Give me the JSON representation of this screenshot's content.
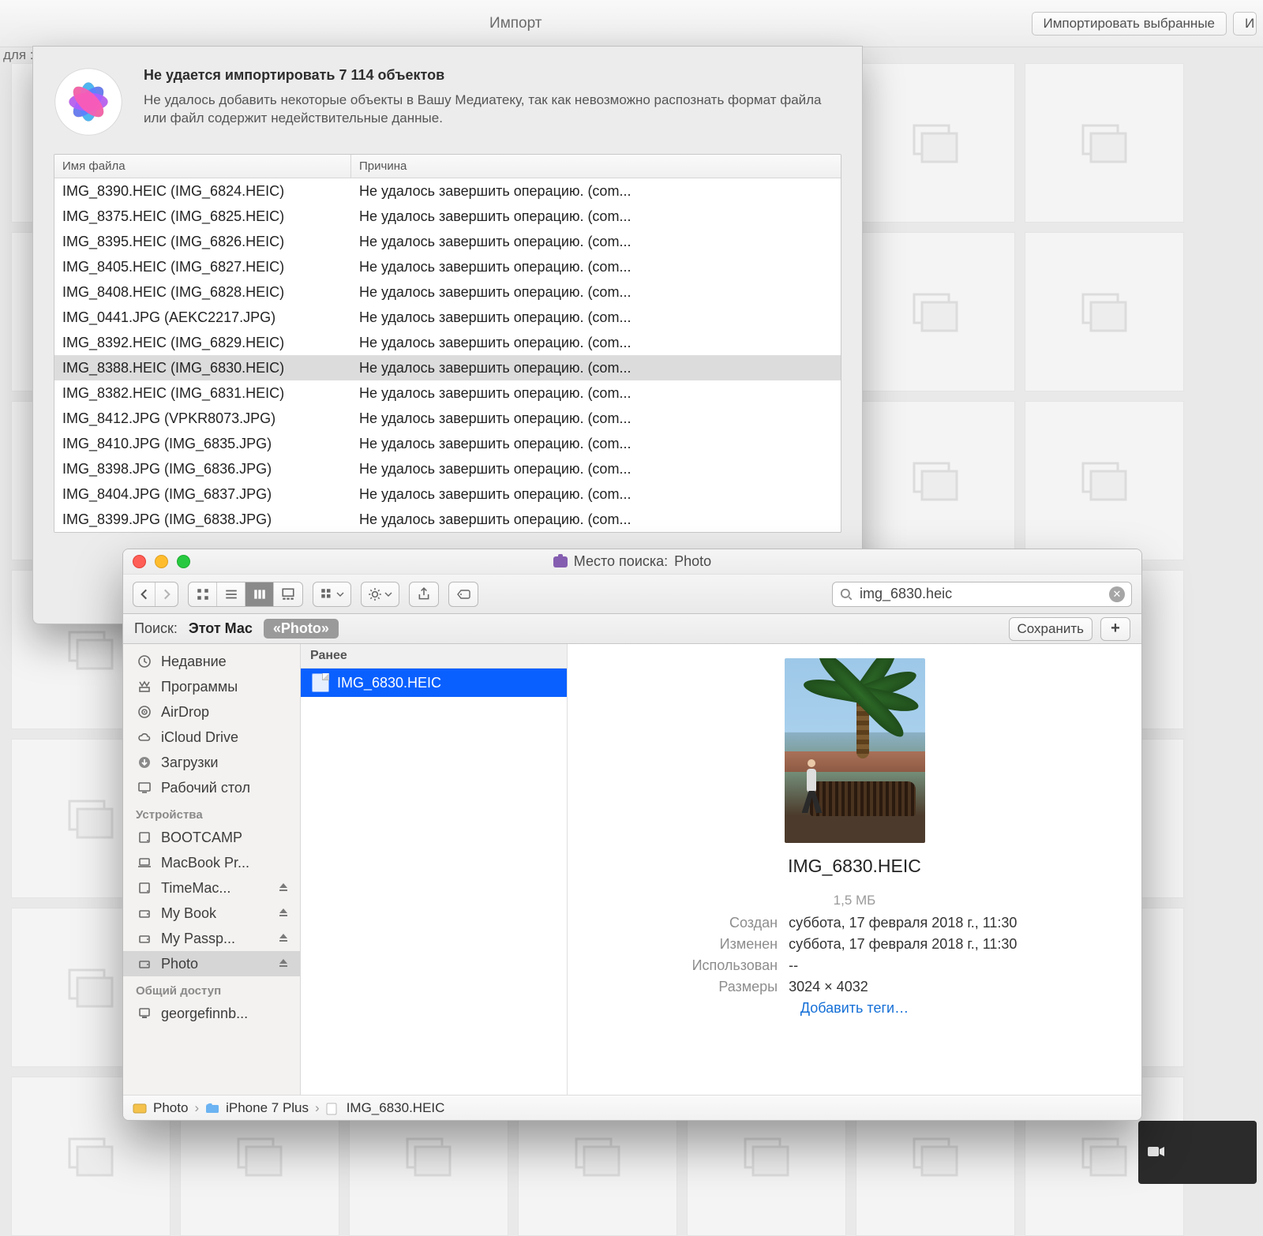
{
  "photos_toolbar": {
    "title": "Импорт",
    "import_selected": "Импортировать выбранные",
    "import_all_fragment": "И"
  },
  "side_hint": "для :",
  "error_dialog": {
    "heading": "Не удается импортировать 7 114 объектов",
    "subtext": "Не удалось добавить некоторые объекты в Вашу Медиатеку, так как невозможно распознать формат файла или файл содержит недействительные данные.",
    "col_file": "Имя файла",
    "col_reason": "Причина",
    "rows": [
      {
        "file": "IMG_8390.HEIC (IMG_6824.HEIC)",
        "reason": "Не удалось завершить операцию. (com...",
        "sel": false
      },
      {
        "file": "IMG_8375.HEIC (IMG_6825.HEIC)",
        "reason": "Не удалось завершить операцию. (com...",
        "sel": false
      },
      {
        "file": "IMG_8395.HEIC (IMG_6826.HEIC)",
        "reason": "Не удалось завершить операцию. (com...",
        "sel": false
      },
      {
        "file": "IMG_8405.HEIC (IMG_6827.HEIC)",
        "reason": "Не удалось завершить операцию. (com...",
        "sel": false
      },
      {
        "file": "IMG_8408.HEIC (IMG_6828.HEIC)",
        "reason": "Не удалось завершить операцию. (com...",
        "sel": false
      },
      {
        "file": "IMG_0441.JPG (AEKC2217.JPG)",
        "reason": "Не удалось завершить операцию. (com...",
        "sel": false
      },
      {
        "file": "IMG_8392.HEIC (IMG_6829.HEIC)",
        "reason": "Не удалось завершить операцию. (com...",
        "sel": false
      },
      {
        "file": "IMG_8388.HEIC (IMG_6830.HEIC)",
        "reason": "Не удалось завершить операцию. (com...",
        "sel": true
      },
      {
        "file": "IMG_8382.HEIC (IMG_6831.HEIC)",
        "reason": "Не удалось завершить операцию. (com...",
        "sel": false
      },
      {
        "file": "IMG_8412.JPG (VPKR8073.JPG)",
        "reason": "Не удалось завершить операцию. (com...",
        "sel": false
      },
      {
        "file": "IMG_8410.JPG (IMG_6835.JPG)",
        "reason": "Не удалось завершить операцию. (com...",
        "sel": false
      },
      {
        "file": "IMG_8398.JPG (IMG_6836.JPG)",
        "reason": "Не удалось завершить операцию. (com...",
        "sel": false
      },
      {
        "file": "IMG_8404.JPG (IMG_6837.JPG)",
        "reason": "Не удалось завершить операцию. (com...",
        "sel": false
      },
      {
        "file": "IMG_8399.JPG (IMG_6838.JPG)",
        "reason": "Не удалось завершить операцию. (com...",
        "sel": false
      }
    ]
  },
  "finder": {
    "title_prefix": "Место поиска:",
    "title_folder": "Photo",
    "search_value": "img_6830.heic",
    "scope": {
      "label": "Поиск:",
      "this_mac": "Этот Мас",
      "photo": "«Photo»",
      "save": "Сохранить"
    },
    "sidebar": {
      "favorites_partial": [
        {
          "icon": "clock-icon",
          "label": "Недавние"
        },
        {
          "icon": "app-grid-icon",
          "label": "Программы"
        },
        {
          "icon": "airdrop-icon",
          "label": "AirDrop"
        },
        {
          "icon": "cloud-icon",
          "label": "iCloud Drive"
        },
        {
          "icon": "download-icon",
          "label": "Загрузки"
        },
        {
          "icon": "desktop-icon",
          "label": "Рабочий стол"
        }
      ],
      "devices_head": "Устройства",
      "devices": [
        {
          "icon": "hdd-icon",
          "label": "BOOTCAMP",
          "eject": false
        },
        {
          "icon": "laptop-icon",
          "label": "MacBook Pr...",
          "eject": false
        },
        {
          "icon": "hdd-icon",
          "label": "TimeMac...",
          "eject": true
        },
        {
          "icon": "ext-hdd-icon",
          "label": "My Book",
          "eject": true
        },
        {
          "icon": "ext-hdd-icon",
          "label": "My Passp...",
          "eject": true
        },
        {
          "icon": "ext-hdd-icon",
          "label": "Photo",
          "eject": true,
          "sel": true
        }
      ],
      "shared_head": "Общий доступ",
      "shared": [
        {
          "icon": "computer-icon",
          "label": "georgefinnb..."
        }
      ]
    },
    "results": {
      "group": "Ранее",
      "items": [
        {
          "name": "IMG_6830.HEIC",
          "sel": true
        }
      ]
    },
    "preview": {
      "name": "IMG_6830.HEIC",
      "size": "1,5 МБ",
      "created_k": "Создан",
      "created_v": "суббота, 17 февраля 2018 г., 11:30",
      "modified_k": "Изменен",
      "modified_v": "суббота, 17 февраля 2018 г., 11:30",
      "used_k": "Использован",
      "used_v": "--",
      "dims_k": "Размеры",
      "dims_v": "3024 × 4032",
      "add_tags": "Добавить теги…"
    },
    "path": [
      "Photo",
      "iPhone 7 Plus",
      "IMG_6830.HEIC"
    ]
  }
}
